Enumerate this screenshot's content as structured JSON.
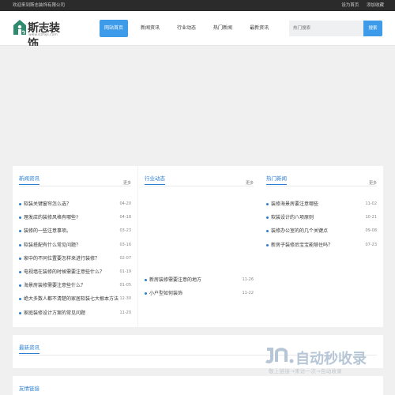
{
  "topbar": {
    "welcome": "欢迎来到斯志装饰有限公司",
    "set_home": "设为首页",
    "add_favorite": "添加收藏"
  },
  "logo": {
    "brand": "斯志装饰",
    "url": "www.sizhijs.com",
    "color": "#2f8a6e"
  },
  "nav": {
    "items": [
      "网站首页",
      "新闻资讯",
      "行业动态",
      "热门新闻",
      "最新资讯"
    ]
  },
  "search": {
    "placeholder": "热门搜索",
    "button": "搜索"
  },
  "accent": "#3d9be9",
  "panels": {
    "news": {
      "title": "新闻资讯",
      "more": "更多",
      "items": [
        {
          "text": "软装关键窗帘怎么选？",
          "date": "04-20"
        },
        {
          "text": "理发店的装修风格有哪些?",
          "date": "04-18"
        },
        {
          "text": "装修的一些注意事项。",
          "date": "03-23"
        },
        {
          "text": "软装搭配有什么常见问题？",
          "date": "03-16"
        },
        {
          "text": "家中的不同位置要怎样来进行装修？",
          "date": "02-07"
        },
        {
          "text": "电视墙在装修的时候需要注意些什么？",
          "date": "01-19"
        },
        {
          "text": "海景房装修需要注意些什么？",
          "date": "01-05"
        },
        {
          "text": "绝大多数人都不清楚的家居软装七大根本方法",
          "date": "12-30"
        },
        {
          "text": "家庭装修设计方案的常见问题",
          "date": "11-20"
        }
      ]
    },
    "industry": {
      "title": "行业动态",
      "more": "更多",
      "items": [
        {
          "text": "新房装修需要注意的地方",
          "date": "11-26"
        },
        {
          "text": "小户型如何装饰",
          "date": "11-22"
        }
      ]
    },
    "hot": {
      "title": "热门新闻",
      "more": "更多",
      "items": [
        {
          "text": "装修海景房要注意哪些",
          "date": "11-02"
        },
        {
          "text": "软装设计的八项原则",
          "date": "10-21"
        },
        {
          "text": "装修办公室的的几个关键点",
          "date": "09-08"
        },
        {
          "text": "新房子装修后宝宝能够住吗？",
          "date": "07-23"
        }
      ]
    }
  },
  "latest": {
    "title": "最新资讯"
  },
  "friend_links": {
    "title": "友情链接"
  },
  "watermark": {
    "main": "自动秒收录",
    "sub": "敬上链接→来访一次→自动收录"
  }
}
